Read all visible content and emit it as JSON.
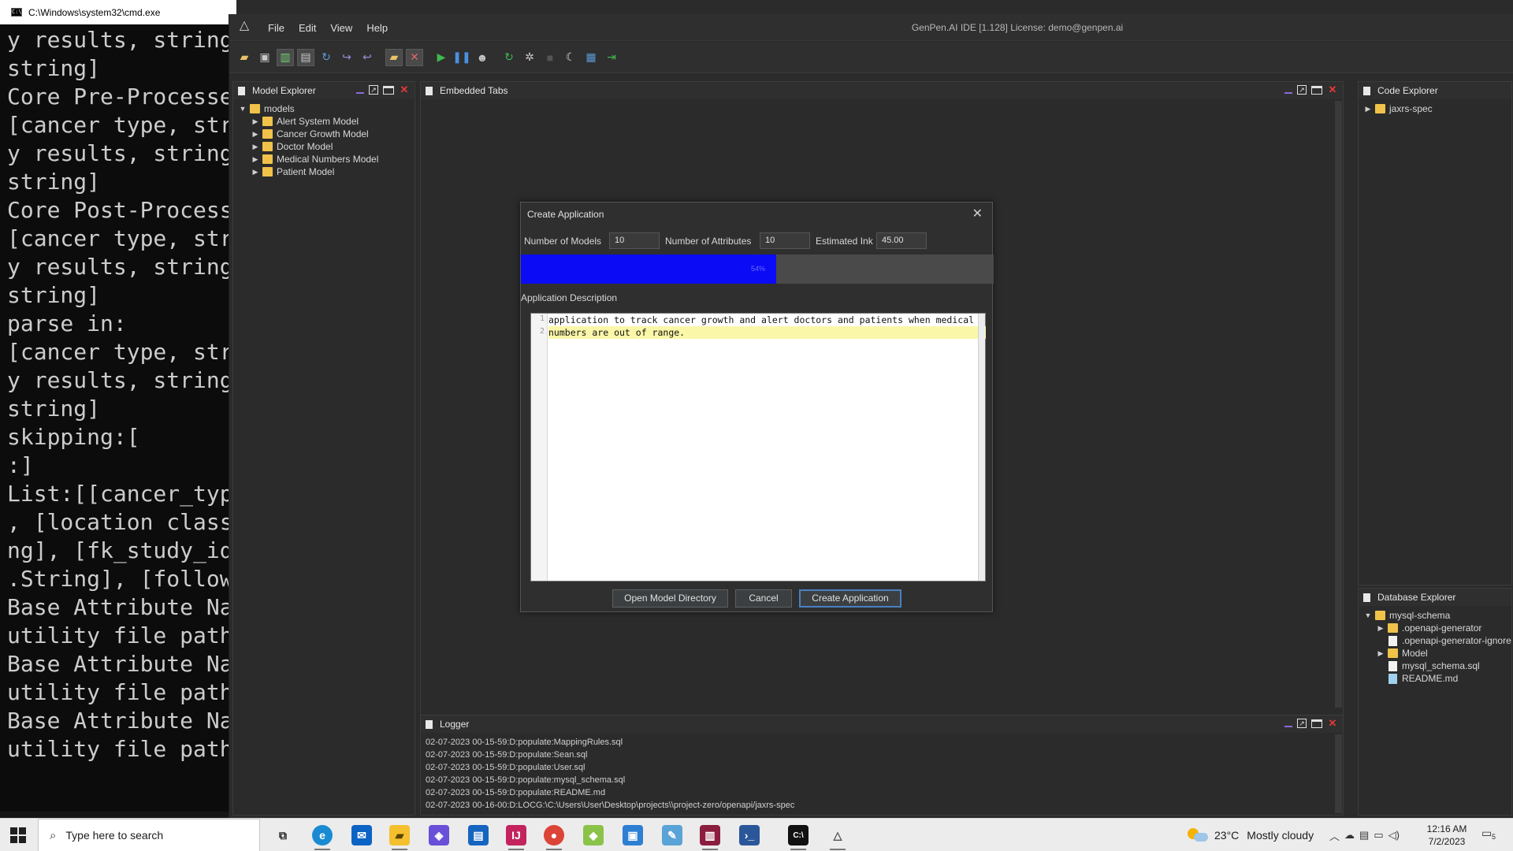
{
  "cmd": {
    "title": "C:\\Windows\\system32\\cmd.exe",
    "lines": [
      "y results, string",
      "string]",
      "Core Pre-Processe",
      "[cancer type, str",
      "y results, string",
      "string]",
      "Core Post-Process",
      "[cancer type, str",
      "y results, string",
      "string]",
      "parse in:",
      "[cancer type, str",
      "y results, string",
      "string]",
      "skipping:[",
      ":]",
      "List:[[cancer_typ",
      ", [location class",
      "ng], [fk_study_id",
      ".String], [follow",
      "Base Attribute Na",
      "utility file path",
      "Base Attribute Na",
      "utility file path",
      "Base Attribute Na",
      "utility file path"
    ]
  },
  "ide": {
    "title": "GenPen.AI IDE [1.128] License: demo@genpen.ai",
    "menu": [
      "File",
      "Edit",
      "View",
      "Help"
    ],
    "toolbar_icons": [
      "open-folder-icon",
      "save-icon",
      "columns-icon",
      "document-icon",
      "refresh-icon",
      "redo-icon",
      "undo-icon",
      "folder-icon",
      "folder-remove-icon",
      "play-icon",
      "pause-icon",
      "bug-icon",
      "run-config-icon",
      "settings-icon",
      "stop-icon",
      "moon-icon",
      "database-icon",
      "export-icon"
    ]
  },
  "model_explorer": {
    "title": "Model Explorer",
    "root": "models",
    "items": [
      "Alert System Model",
      "Cancer Growth Model",
      "Doctor Model",
      "Medical Numbers Model",
      "Patient Model"
    ]
  },
  "embedded_tabs": {
    "title": "Embedded Tabs"
  },
  "code_explorer": {
    "title": "Code Explorer",
    "items": [
      "jaxrs-spec"
    ]
  },
  "database_explorer": {
    "title": "Database Explorer",
    "root": "mysql-schema",
    "items": [
      {
        "label": ".openapi-generator",
        "type": "folder",
        "expandable": true
      },
      {
        "label": ".openapi-generator-ignore",
        "type": "file",
        "expandable": false
      },
      {
        "label": "Model",
        "type": "folder",
        "expandable": true
      },
      {
        "label": "mysql_schema.sql",
        "type": "file",
        "expandable": false
      },
      {
        "label": "README.md",
        "type": "md",
        "expandable": false
      }
    ]
  },
  "logger": {
    "title": "Logger",
    "lines": [
      "02-07-2023 00-15-59:D:populate:MappingRules.sql",
      "02-07-2023 00-15-59:D:populate:Sean.sql",
      "02-07-2023 00-15-59:D:populate:User.sql",
      "02-07-2023 00-15-59:D:populate:mysql_schema.sql",
      "02-07-2023 00-15-59:D:populate:README.md",
      "02-07-2023 00-16-00:D:LOCG:\\C:\\Users\\User\\Desktop\\projects\\\\project-zero/openapi/jaxrs-spec"
    ]
  },
  "dialog": {
    "title": "Create Application",
    "num_models_label": "Number of Models",
    "num_models_value": "10",
    "num_attributes_label": "Number of Attributes",
    "num_attributes_value": "10",
    "estimated_ink_label": "Estimated Ink",
    "estimated_ink_value": "45.00",
    "progress_percent": 54,
    "progress_label": "54%",
    "progress_color": "#0b0bf5",
    "description_label": "Application Description",
    "description_lines": [
      "application to track cancer growth and alert doctors and patients when medical",
      "numbers are out of range."
    ],
    "line_numbers": [
      "1",
      "2"
    ],
    "buttons": {
      "open_dir": "Open Model Directory",
      "cancel": "Cancel",
      "create": "Create Application"
    }
  },
  "taskbar": {
    "search_placeholder": "Type here to search",
    "weather_temp": "23°C",
    "weather_text": "Mostly cloudy",
    "time": "12:16 AM",
    "date": "7/2/2023",
    "notification_count": "5"
  }
}
